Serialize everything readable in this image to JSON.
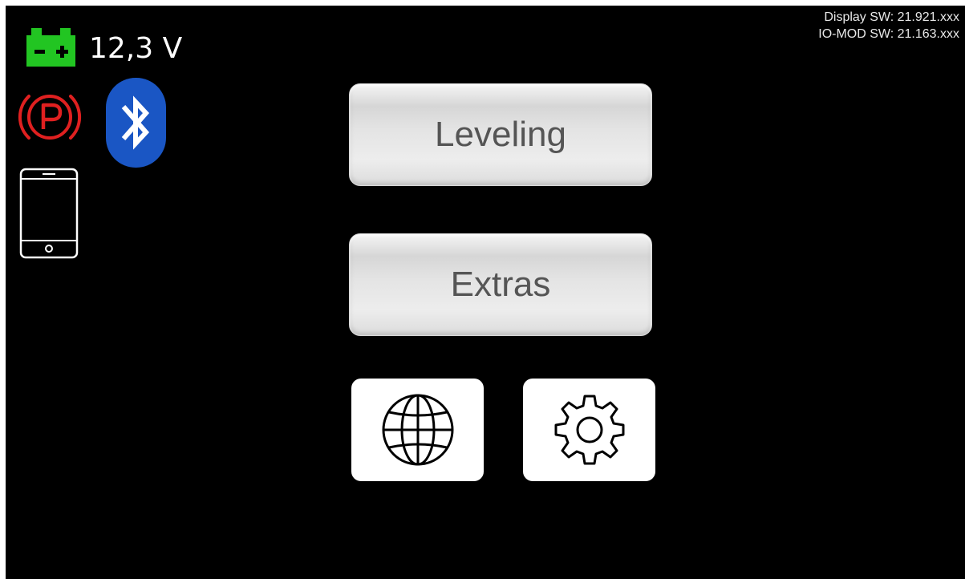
{
  "header": {
    "display_sw": "Display SW: 21.921.xxx",
    "io_mod_sw": "IO-MOD SW: 21.163.xxx"
  },
  "status": {
    "battery_voltage": "12,3 V",
    "battery_icon": "battery-icon",
    "parking_brake_icon": "parking-brake-icon",
    "bluetooth_icon": "bluetooth-icon",
    "phone_icon": "smartphone-icon"
  },
  "menu": {
    "leveling_label": "Leveling",
    "extras_label": "Extras",
    "language_icon": "globe-icon",
    "settings_icon": "gear-icon"
  },
  "colors": {
    "background": "#000000",
    "battery": "#22c522",
    "parking_brake": "#e02020",
    "bluetooth": "#1a56c4",
    "button_text": "#555555"
  }
}
